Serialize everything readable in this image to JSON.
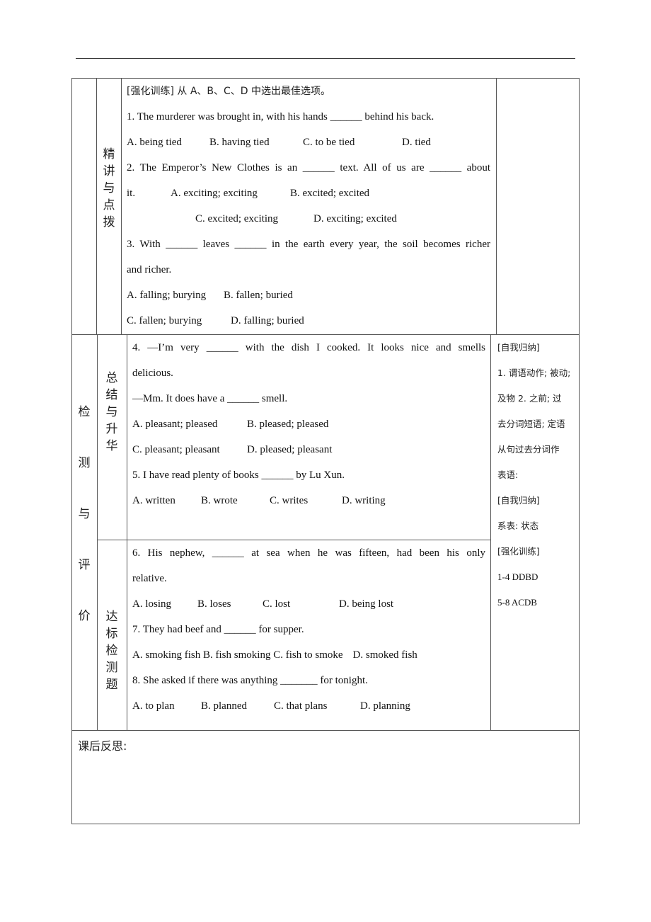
{
  "section_top": {
    "label_col2": [
      "精",
      "讲",
      "与",
      "点",
      "拨"
    ],
    "intro": "[强化训练]  从 A、B、C、D 中选出最佳选项。",
    "q1": {
      "stem": "1. The murderer was brought in, with his hands ______ behind his back.",
      "options": [
        "A. being tied",
        "B. having tied",
        "C. to be tied",
        "D. tied"
      ]
    },
    "q2": {
      "stem_line1": "2. The Emperor’s New Clothes is an ______ text. All of us are ______ about",
      "stem_line2": "it.",
      "options_row1": [
        "A. exciting; exciting",
        "B. excited; excited"
      ],
      "options_row2": [
        "C. excited; exciting",
        "D. exciting; excited"
      ]
    },
    "q3": {
      "stem_line1": "3. With ______ leaves ______ in the earth every year, the soil becomes richer",
      "stem_line2": "and richer.",
      "options_row1": [
        "A. falling; burying",
        "B. fallen; buried"
      ],
      "options_row2": [
        "C. fallen; burying",
        "D. falling; buried"
      ]
    }
  },
  "section_bottom": {
    "label_col1": [
      "检",
      "测",
      "与",
      "评",
      "价"
    ],
    "sub1": {
      "label": [
        "总",
        "结",
        "与",
        "升",
        "华"
      ],
      "q4": {
        "stem_line1": "4. —I’m very ______ with the dish I cooked. It looks nice and smells",
        "stem_line2": "delicious.",
        "stem_line3": "—Mm. It does have a ______ smell.",
        "options_row1": [
          "A. pleasant; pleased",
          "B. pleased; pleased"
        ],
        "options_row2": [
          "C. pleasant; pleasant",
          "D. pleased; pleasant"
        ]
      },
      "q5": {
        "stem": "5. I have read plenty of books ______ by Lu Xun.",
        "options": [
          "A. written",
          "B. wrote",
          "C. writes",
          "D. writing"
        ]
      }
    },
    "sub2": {
      "label": [
        "达",
        "标",
        "检",
        "测",
        "题"
      ],
      "q6": {
        "stem_line1": "6. His nephew, ______ at sea when he was fifteen, had been his only",
        "stem_line2": "relative.",
        "options": [
          "A. losing",
          "B. loses",
          "C. lost",
          "D. being lost"
        ]
      },
      "q7": {
        "stem": "7. They had beef and ______ for supper.",
        "options": [
          "A. smoking fish",
          "B. fish smoking",
          "C. fish to smoke",
          "D. smoked fish"
        ]
      },
      "q8": {
        "stem": "8. She asked if there was anything _______ for tonight.",
        "options": [
          "A. to plan",
          "B. planned",
          "C. that plans",
          "D. planning"
        ]
      }
    },
    "side_notes": [
      "[自我归纳]",
      "1. 谓语动作; 被动;",
      "及物   2. 之前; 过",
      "去分词短语; 定语",
      "从句过去分词作",
      "表语:",
      "[自我归纳]",
      "系表: 状态",
      "[强化训练]",
      "1-4 DDBD",
      "5-8 ACDB"
    ]
  },
  "reflection": {
    "label": "课后反思:"
  }
}
